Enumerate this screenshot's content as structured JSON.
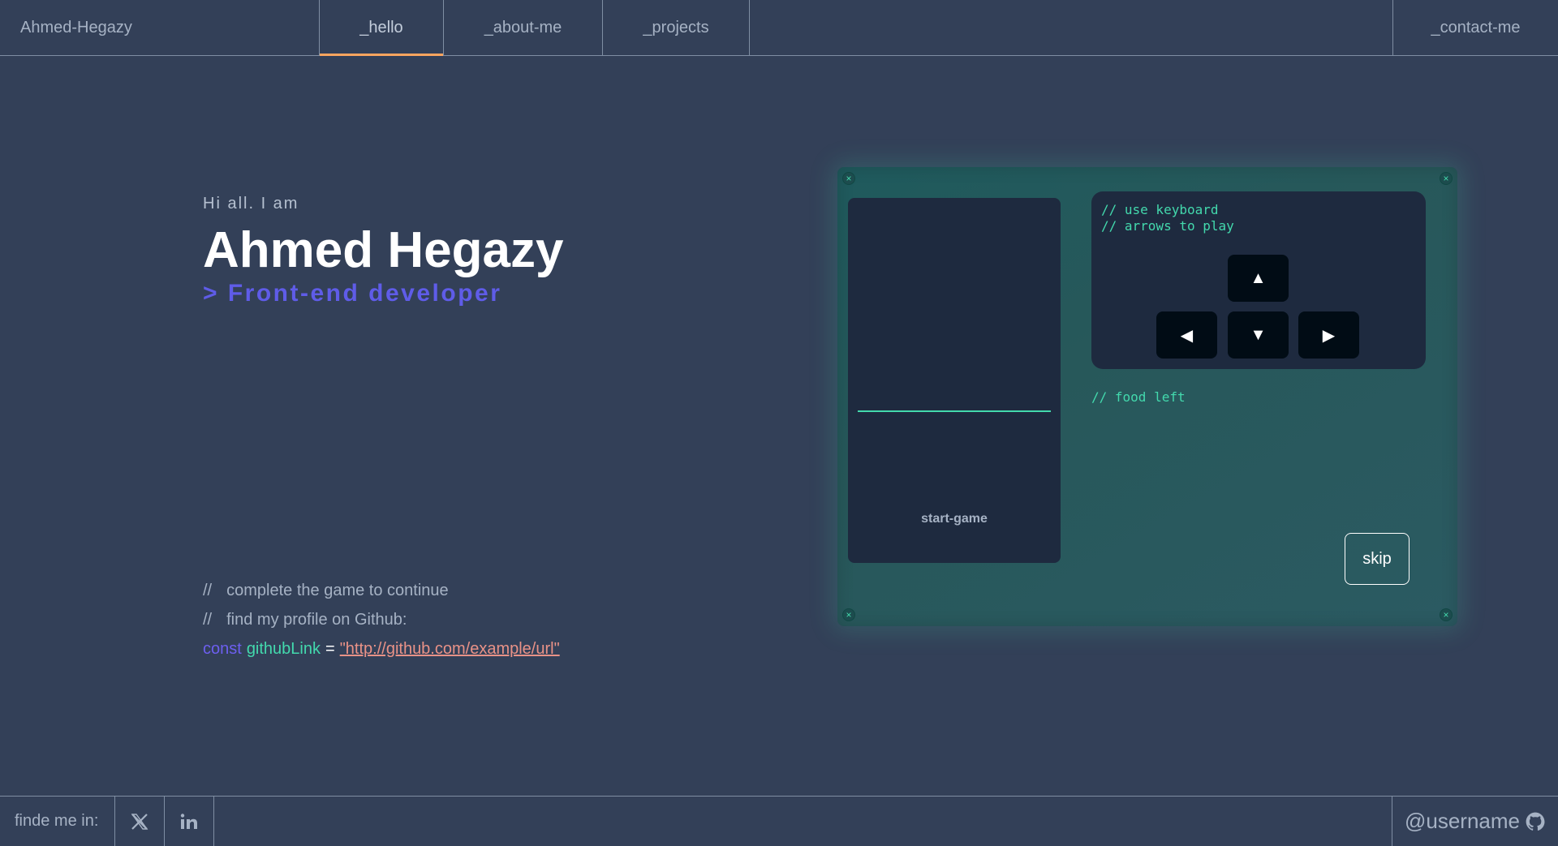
{
  "header": {
    "brand": "Ahmed-Hegazy",
    "tabs": [
      {
        "label": "_hello",
        "active": true
      },
      {
        "label": "_about-me",
        "active": false
      },
      {
        "label": "_projects",
        "active": false
      }
    ],
    "contact": "_contact-me"
  },
  "hero": {
    "greeting": "Hi all. I am",
    "name": "Ahmed Hegazy",
    "role": "> Front-end developer"
  },
  "comments": {
    "slashes": "//",
    "line1": "complete the game to continue",
    "line2": "find my profile on Github:"
  },
  "code": {
    "keyword": "const",
    "variable": "githubLink",
    "operator": "=",
    "value": "\"http://github.com/example/url\""
  },
  "game": {
    "instructions_line1": "// use keyboard",
    "instructions_line2": "// arrows to play",
    "food_left": "// food left",
    "start_label": "start-game",
    "skip_label": "skip",
    "keys": {
      "up": "▲",
      "left": "◀",
      "down": "▼",
      "right": "▶"
    }
  },
  "footer": {
    "find_label": "finde me in:",
    "github_user": "@username",
    "socials": [
      "x-icon",
      "linkedin-icon"
    ]
  },
  "colors": {
    "background": "#334058",
    "accent_orange": "#fea55f",
    "accent_green": "#43d9ad",
    "accent_purple": "#5f5ce8",
    "string_color": "#e99287"
  }
}
